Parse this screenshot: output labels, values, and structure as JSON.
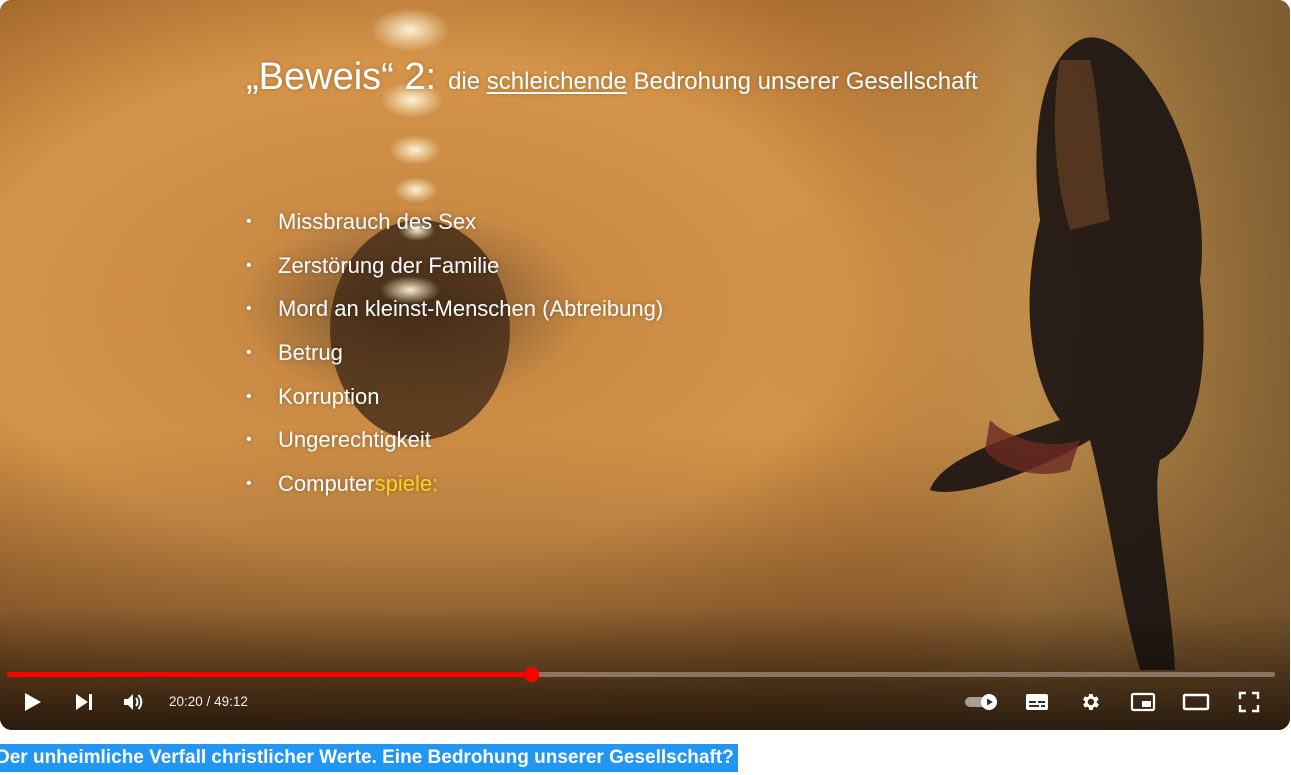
{
  "slide": {
    "title_prefix": "„Beweis“ 2:",
    "title_sub_before": "die",
    "title_sub_underlined": "schleichende",
    "title_sub_after": "Bedrohung unserer Gesellschaft",
    "bullet_glyph": "•",
    "bullets": [
      "Missbrauch des Sex",
      "Zerstörung der Familie",
      "Mord an kleinst-Menschen (Abtreibung)",
      "Betrug",
      "Korruption",
      "Ungerechtigkeit"
    ],
    "last_bullet_prefix": "Computer",
    "last_bullet_highlight": "spiele:"
  },
  "player": {
    "current_time": "20:20",
    "duration": "49:12",
    "time_separator": " / ",
    "progress_fraction": 0.4134,
    "buffered_fraction": 0.4134,
    "controls": {
      "play": "play-icon",
      "next": "next-icon",
      "volume": "volume-icon",
      "autoplay": "autoplay-toggle-icon",
      "subtitles": "subtitles-icon",
      "settings": "gear-icon",
      "miniplayer": "miniplayer-icon",
      "theater": "theater-mode-icon",
      "fullscreen": "fullscreen-icon"
    }
  },
  "caption": {
    "text": "Der unheimliche Verfall christlicher Werte. Eine Bedrohung unserer Gesellschaft?"
  },
  "colors": {
    "progress_played": "#ff0000",
    "caption_bg": "#2196f3",
    "highlight_text": "#ffd21a"
  }
}
